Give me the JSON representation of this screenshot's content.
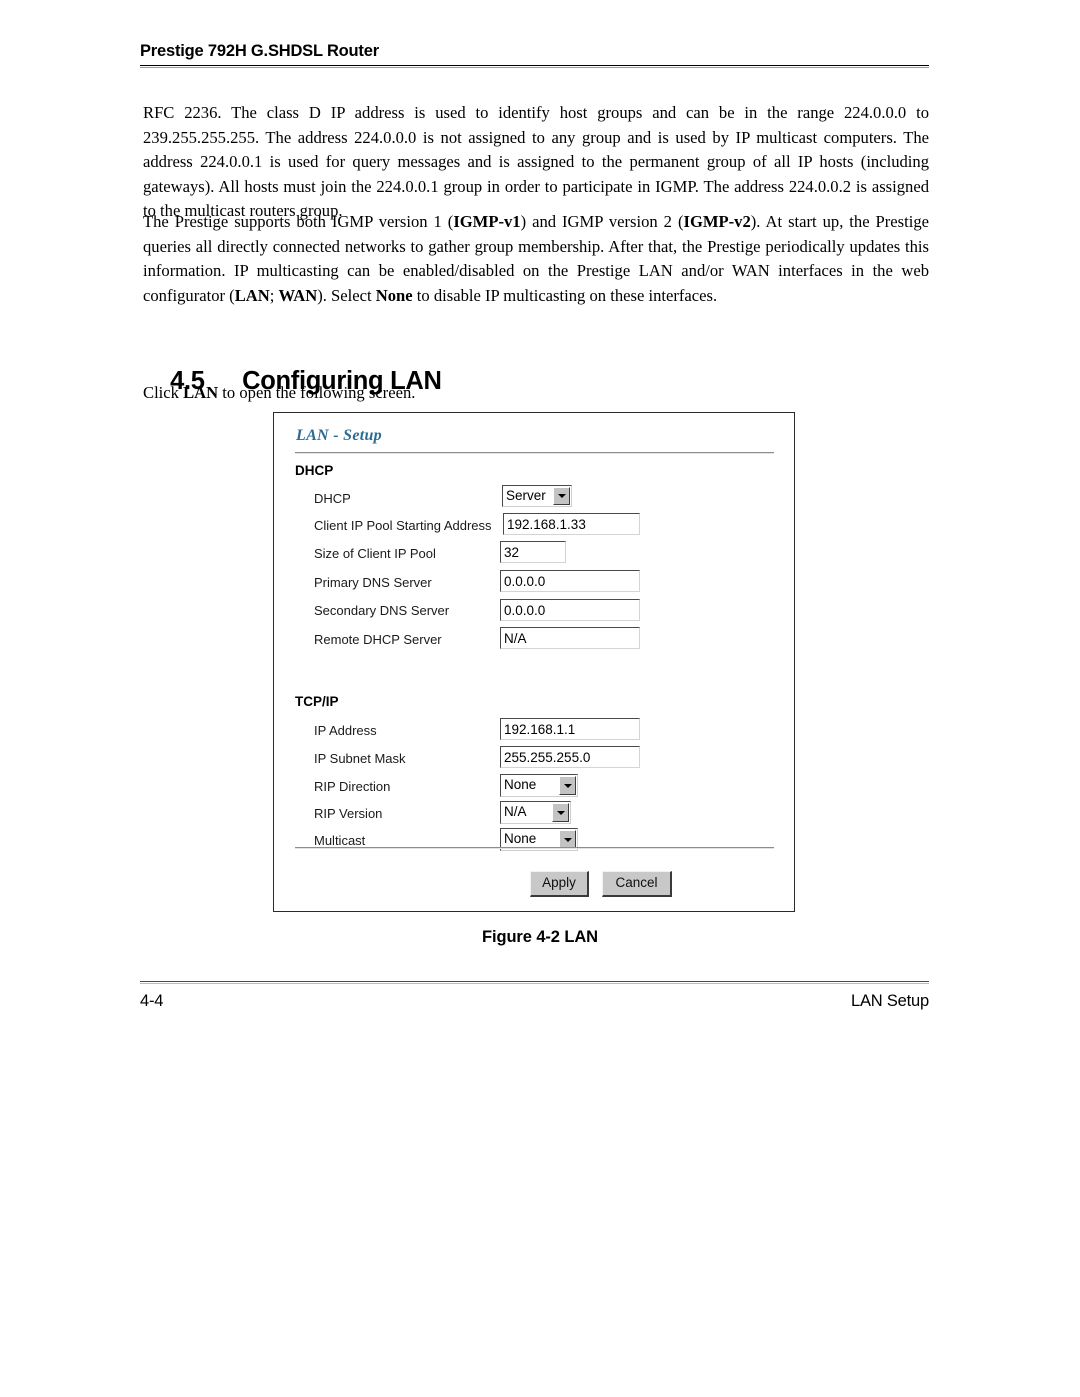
{
  "header": {
    "title": "Prestige 792H G.SHDSL Router"
  },
  "body": {
    "paragraph1_parts": [
      {
        "text": "RFC 2236. The class D IP address is used to identify host groups and can be in the range 224.0.0.0 to 239.255.255.255. The address 224.0.0.0 is not assigned to any group and is used by IP multicast computers. The address 224.0.0.1 is used for query messages and is assigned to the permanent group of all IP hosts (including gateways). All hosts must join the 224.0.0.1 group in order to participate in IGMP. The address 224.0.0.2 is assigned to the multicast routers group.",
        "bold": false
      }
    ],
    "paragraph2_parts": [
      {
        "text": "The Prestige supports both IGMP version 1 (",
        "bold": false
      },
      {
        "text": "IGMP-v1",
        "bold": true
      },
      {
        "text": ") and IGMP version 2 (",
        "bold": false
      },
      {
        "text": "IGMP-v2",
        "bold": true
      },
      {
        "text": "). At start up, the Prestige queries all directly connected networks to gather group membership. After that, the Prestige periodically updates this information. IP multicasting can be enabled/disabled on the Prestige LAN and/or WAN interfaces in the web configurator (",
        "bold": false
      },
      {
        "text": "LAN",
        "bold": true
      },
      {
        "text": "; ",
        "bold": false
      },
      {
        "text": "WAN",
        "bold": true
      },
      {
        "text": "). Select ",
        "bold": false
      },
      {
        "text": "None",
        "bold": true
      },
      {
        "text": " to disable IP multicasting on these interfaces.",
        "bold": false
      }
    ]
  },
  "section": {
    "number": "4.5",
    "title": "Configuring LAN",
    "intro_parts": [
      {
        "text": "Click ",
        "bold": false
      },
      {
        "text": "LAN",
        "bold": true
      },
      {
        "text": " to open the following screen.",
        "bold": false
      }
    ]
  },
  "screenshot": {
    "title": "LAN - Setup",
    "title_color": "#2c6b93",
    "dhcp": {
      "group_label": "DHCP",
      "fields": [
        {
          "label": "DHCP",
          "type": "select",
          "value": "Server"
        },
        {
          "label": "Client IP Pool Starting Address",
          "type": "text",
          "value": "192.168.1.33"
        },
        {
          "label": "Size of Client IP Pool",
          "type": "text",
          "value": "32"
        },
        {
          "label": "Primary DNS Server",
          "type": "text",
          "value": "0.0.0.0"
        },
        {
          "label": "Secondary DNS Server",
          "type": "text",
          "value": "0.0.0.0"
        },
        {
          "label": "Remote DHCP Server",
          "type": "text",
          "value": "N/A"
        }
      ]
    },
    "tcpip": {
      "group_label": "TCP/IP",
      "fields": [
        {
          "label": "IP Address",
          "type": "text",
          "value": "192.168.1.1"
        },
        {
          "label": "IP Subnet Mask",
          "type": "text",
          "value": "255.255.255.0"
        },
        {
          "label": "RIP Direction",
          "type": "select",
          "value": "None"
        },
        {
          "label": "RIP Version",
          "type": "select",
          "value": "N/A"
        },
        {
          "label": "Multicast",
          "type": "select",
          "value": "None"
        }
      ]
    },
    "buttons": {
      "apply": "Apply",
      "cancel": "Cancel"
    }
  },
  "figure": {
    "caption": "Figure 4-2 LAN"
  },
  "footer": {
    "page_number": "4-4",
    "chapter": "LAN Setup"
  }
}
